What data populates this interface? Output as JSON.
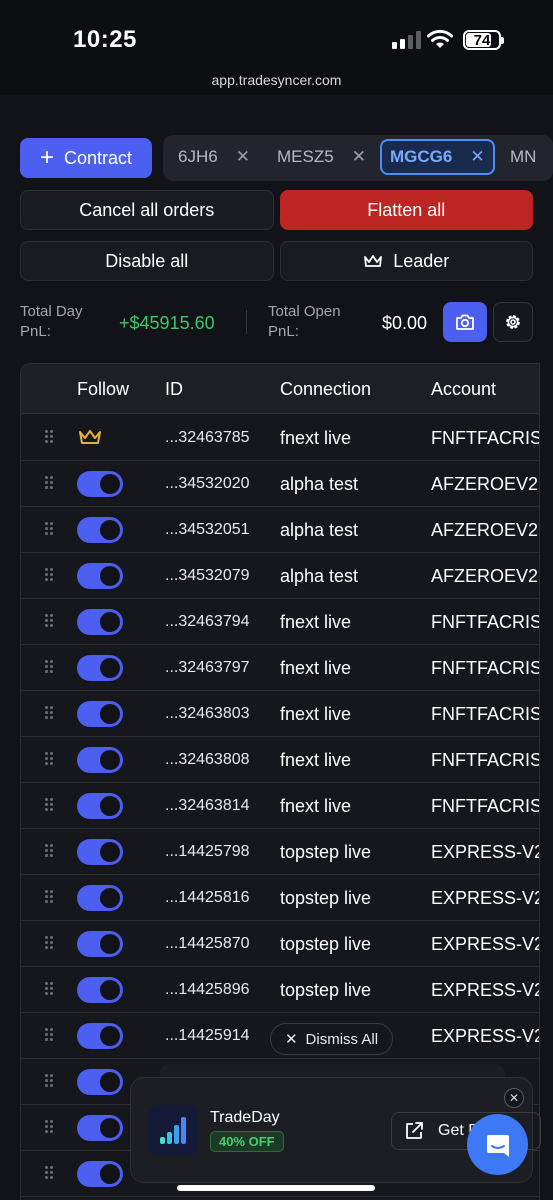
{
  "status_bar": {
    "time": "10:25",
    "battery": "74",
    "url": "app.tradesyncer.com"
  },
  "toolbar": {
    "contract_label": "Contract",
    "tabs": [
      {
        "label": "6JH6",
        "active": false
      },
      {
        "label": "MESZ5",
        "active": false
      },
      {
        "label": "MGCG6",
        "active": true
      },
      {
        "label": "MN",
        "active": false
      }
    ]
  },
  "actions": {
    "cancel_all_orders": "Cancel all orders",
    "flatten_all": "Flatten all",
    "disable_all": "Disable all",
    "leader": "Leader"
  },
  "pnl": {
    "total_day_label_1": "Total Day",
    "total_day_label_2": "PnL:",
    "total_day_value": "+$45915.60",
    "total_open_label_1": "Total Open",
    "total_open_label_2": "PnL:",
    "total_open_value": "$0.00"
  },
  "table": {
    "columns": [
      "Follow",
      "ID",
      "Connection",
      "Account"
    ],
    "rows": [
      {
        "leader": true,
        "id": "...32463785",
        "connection": "fnext live",
        "account": "FNFTFACRIS"
      },
      {
        "leader": false,
        "id": "...34532020",
        "connection": "alpha test",
        "account": "AFZEROEV2"
      },
      {
        "leader": false,
        "id": "...34532051",
        "connection": "alpha test",
        "account": "AFZEROEV2"
      },
      {
        "leader": false,
        "id": "...34532079",
        "connection": "alpha test",
        "account": "AFZEROEV2"
      },
      {
        "leader": false,
        "id": "...32463794",
        "connection": "fnext live",
        "account": "FNFTFACRIS"
      },
      {
        "leader": false,
        "id": "...32463797",
        "connection": "fnext live",
        "account": "FNFTFACRIS"
      },
      {
        "leader": false,
        "id": "...32463803",
        "connection": "fnext live",
        "account": "FNFTFACRIS"
      },
      {
        "leader": false,
        "id": "...32463808",
        "connection": "fnext live",
        "account": "FNFTFACRIS"
      },
      {
        "leader": false,
        "id": "...32463814",
        "connection": "fnext live",
        "account": "FNFTFACRIS"
      },
      {
        "leader": false,
        "id": "...14425798",
        "connection": "topstep live",
        "account": "EXPRESS-V2"
      },
      {
        "leader": false,
        "id": "...14425816",
        "connection": "topstep live",
        "account": "EXPRESS-V2"
      },
      {
        "leader": false,
        "id": "...14425870",
        "connection": "topstep live",
        "account": "EXPRESS-V2"
      },
      {
        "leader": false,
        "id": "...14425896",
        "connection": "topstep live",
        "account": "EXPRESS-V2"
      },
      {
        "leader": false,
        "id": "...14425914",
        "connection": "",
        "account": "EXPRESS-V2"
      },
      {
        "leader": false,
        "id": "",
        "connection": "",
        "account": ""
      },
      {
        "leader": false,
        "id": "",
        "connection": "",
        "account": ""
      },
      {
        "leader": false,
        "id": "",
        "connection": "",
        "account": ""
      }
    ]
  },
  "toast": {
    "dismiss_all": "Dismiss All"
  },
  "promo": {
    "name": "TradeDay",
    "badge": "40% OFF",
    "cta": "Get D"
  },
  "colors": {
    "accent": "#4c5ff0",
    "danger": "#bd2522",
    "positive": "#3cc76a",
    "active_tab": "#4c8dfa"
  }
}
